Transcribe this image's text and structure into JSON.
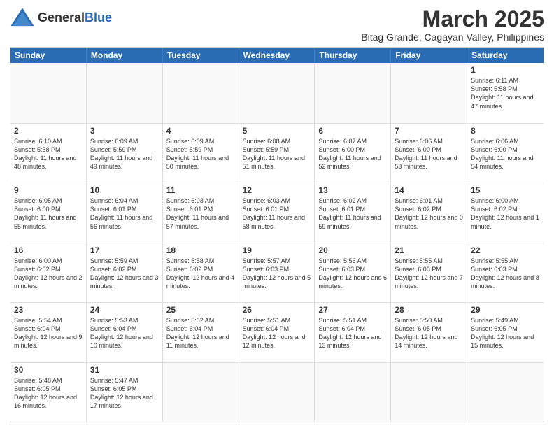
{
  "header": {
    "logo_general": "General",
    "logo_blue": "Blue",
    "title": "March 2025",
    "subtitle": "Bitag Grande, Cagayan Valley, Philippines"
  },
  "weekdays": [
    "Sunday",
    "Monday",
    "Tuesday",
    "Wednesday",
    "Thursday",
    "Friday",
    "Saturday"
  ],
  "rows": [
    [
      {
        "day": "",
        "info": ""
      },
      {
        "day": "",
        "info": ""
      },
      {
        "day": "",
        "info": ""
      },
      {
        "day": "",
        "info": ""
      },
      {
        "day": "",
        "info": ""
      },
      {
        "day": "",
        "info": ""
      },
      {
        "day": "1",
        "info": "Sunrise: 6:11 AM\nSunset: 5:58 PM\nDaylight: 11 hours and 47 minutes."
      }
    ],
    [
      {
        "day": "2",
        "info": "Sunrise: 6:10 AM\nSunset: 5:58 PM\nDaylight: 11 hours and 48 minutes."
      },
      {
        "day": "3",
        "info": "Sunrise: 6:09 AM\nSunset: 5:59 PM\nDaylight: 11 hours and 49 minutes."
      },
      {
        "day": "4",
        "info": "Sunrise: 6:09 AM\nSunset: 5:59 PM\nDaylight: 11 hours and 50 minutes."
      },
      {
        "day": "5",
        "info": "Sunrise: 6:08 AM\nSunset: 5:59 PM\nDaylight: 11 hours and 51 minutes."
      },
      {
        "day": "6",
        "info": "Sunrise: 6:07 AM\nSunset: 6:00 PM\nDaylight: 11 hours and 52 minutes."
      },
      {
        "day": "7",
        "info": "Sunrise: 6:06 AM\nSunset: 6:00 PM\nDaylight: 11 hours and 53 minutes."
      },
      {
        "day": "8",
        "info": "Sunrise: 6:06 AM\nSunset: 6:00 PM\nDaylight: 11 hours and 54 minutes."
      }
    ],
    [
      {
        "day": "9",
        "info": "Sunrise: 6:05 AM\nSunset: 6:00 PM\nDaylight: 11 hours and 55 minutes."
      },
      {
        "day": "10",
        "info": "Sunrise: 6:04 AM\nSunset: 6:01 PM\nDaylight: 11 hours and 56 minutes."
      },
      {
        "day": "11",
        "info": "Sunrise: 6:03 AM\nSunset: 6:01 PM\nDaylight: 11 hours and 57 minutes."
      },
      {
        "day": "12",
        "info": "Sunrise: 6:03 AM\nSunset: 6:01 PM\nDaylight: 11 hours and 58 minutes."
      },
      {
        "day": "13",
        "info": "Sunrise: 6:02 AM\nSunset: 6:01 PM\nDaylight: 11 hours and 59 minutes."
      },
      {
        "day": "14",
        "info": "Sunrise: 6:01 AM\nSunset: 6:02 PM\nDaylight: 12 hours and 0 minutes."
      },
      {
        "day": "15",
        "info": "Sunrise: 6:00 AM\nSunset: 6:02 PM\nDaylight: 12 hours and 1 minute."
      }
    ],
    [
      {
        "day": "16",
        "info": "Sunrise: 6:00 AM\nSunset: 6:02 PM\nDaylight: 12 hours and 2 minutes."
      },
      {
        "day": "17",
        "info": "Sunrise: 5:59 AM\nSunset: 6:02 PM\nDaylight: 12 hours and 3 minutes."
      },
      {
        "day": "18",
        "info": "Sunrise: 5:58 AM\nSunset: 6:02 PM\nDaylight: 12 hours and 4 minutes."
      },
      {
        "day": "19",
        "info": "Sunrise: 5:57 AM\nSunset: 6:03 PM\nDaylight: 12 hours and 5 minutes."
      },
      {
        "day": "20",
        "info": "Sunrise: 5:56 AM\nSunset: 6:03 PM\nDaylight: 12 hours and 6 minutes."
      },
      {
        "day": "21",
        "info": "Sunrise: 5:55 AM\nSunset: 6:03 PM\nDaylight: 12 hours and 7 minutes."
      },
      {
        "day": "22",
        "info": "Sunrise: 5:55 AM\nSunset: 6:03 PM\nDaylight: 12 hours and 8 minutes."
      }
    ],
    [
      {
        "day": "23",
        "info": "Sunrise: 5:54 AM\nSunset: 6:04 PM\nDaylight: 12 hours and 9 minutes."
      },
      {
        "day": "24",
        "info": "Sunrise: 5:53 AM\nSunset: 6:04 PM\nDaylight: 12 hours and 10 minutes."
      },
      {
        "day": "25",
        "info": "Sunrise: 5:52 AM\nSunset: 6:04 PM\nDaylight: 12 hours and 11 minutes."
      },
      {
        "day": "26",
        "info": "Sunrise: 5:51 AM\nSunset: 6:04 PM\nDaylight: 12 hours and 12 minutes."
      },
      {
        "day": "27",
        "info": "Sunrise: 5:51 AM\nSunset: 6:04 PM\nDaylight: 12 hours and 13 minutes."
      },
      {
        "day": "28",
        "info": "Sunrise: 5:50 AM\nSunset: 6:05 PM\nDaylight: 12 hours and 14 minutes."
      },
      {
        "day": "29",
        "info": "Sunrise: 5:49 AM\nSunset: 6:05 PM\nDaylight: 12 hours and 15 minutes."
      }
    ],
    [
      {
        "day": "30",
        "info": "Sunrise: 5:48 AM\nSunset: 6:05 PM\nDaylight: 12 hours and 16 minutes."
      },
      {
        "day": "31",
        "info": "Sunrise: 5:47 AM\nSunset: 6:05 PM\nDaylight: 12 hours and 17 minutes."
      },
      {
        "day": "",
        "info": ""
      },
      {
        "day": "",
        "info": ""
      },
      {
        "day": "",
        "info": ""
      },
      {
        "day": "",
        "info": ""
      },
      {
        "day": "",
        "info": ""
      }
    ]
  ]
}
